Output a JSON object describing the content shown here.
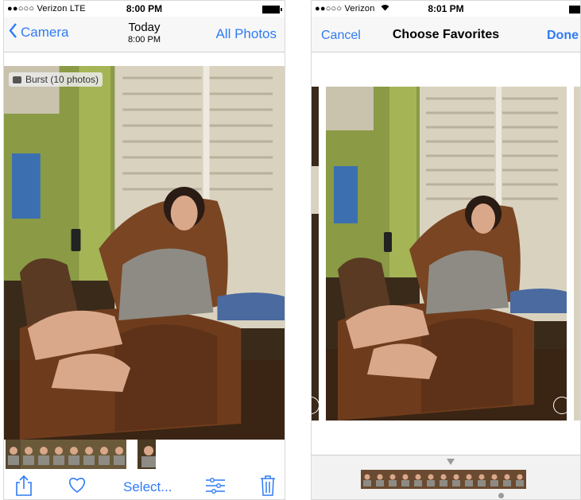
{
  "left": {
    "status": {
      "carrier": "●●○○○ Verizon  LTE",
      "time": "8:00 PM"
    },
    "nav": {
      "back_label": "Camera",
      "title": "Today",
      "subtitle": "8:00 PM",
      "right_label": "All Photos"
    },
    "burst_label": "Burst (10 photos)",
    "toolbar": {
      "select_label": "Select...",
      "icons": [
        "share-icon",
        "heart-icon",
        "adjust-icon",
        "trash-icon"
      ]
    }
  },
  "right": {
    "status": {
      "carrier": "●●○○○ Verizon",
      "time": "8:01 PM"
    },
    "nav": {
      "cancel_label": "Cancel",
      "title": "Choose Favorites",
      "done_label": "Done"
    }
  },
  "colors": {
    "accent": "#2f7bf5",
    "wall": "#7f9a3a",
    "chair": "#6b3a1e",
    "shutter": "#e9e4d8"
  }
}
